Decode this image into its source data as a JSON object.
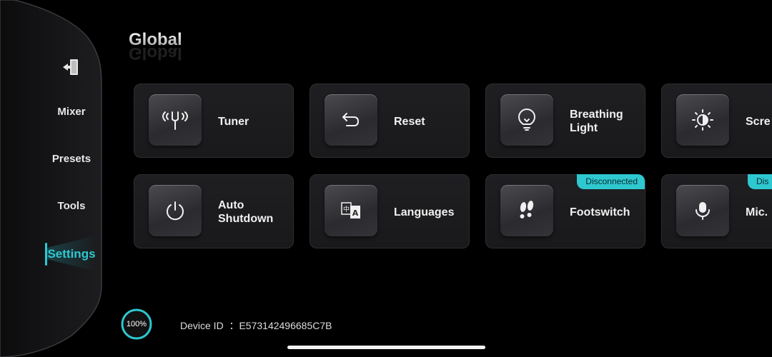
{
  "sidebar": {
    "exit_icon": "exit-door-icon",
    "items": [
      {
        "label": "Mixer"
      },
      {
        "label": "Presets"
      },
      {
        "label": "Tools"
      },
      {
        "label": "Settings",
        "active": true
      }
    ]
  },
  "page": {
    "title": "Global"
  },
  "cards": [
    {
      "label": "Tuner",
      "icon": "tuning-fork-icon"
    },
    {
      "label": "Reset",
      "icon": "undo-arrow-icon"
    },
    {
      "label": "Breathing Light",
      "icon": "lightbulb-icon"
    },
    {
      "label": "Scre Light",
      "icon": "brightness-icon"
    },
    {
      "label": "Auto Shutdown",
      "icon": "power-icon"
    },
    {
      "label": "Languages",
      "icon": "translate-icon"
    },
    {
      "label": "Footswitch",
      "icon": "footprints-icon",
      "badge": "Disconnected"
    },
    {
      "label": "Mic.",
      "icon": "microphone-icon",
      "badge": "Dis"
    }
  ],
  "footer": {
    "battery": "100%",
    "device_id_label": "Device ID",
    "device_id_value": "：E573142496685C7B"
  },
  "colors": {
    "accent": "#2ec8d0",
    "card_bg": "#1f1f22",
    "background": "#000000"
  }
}
